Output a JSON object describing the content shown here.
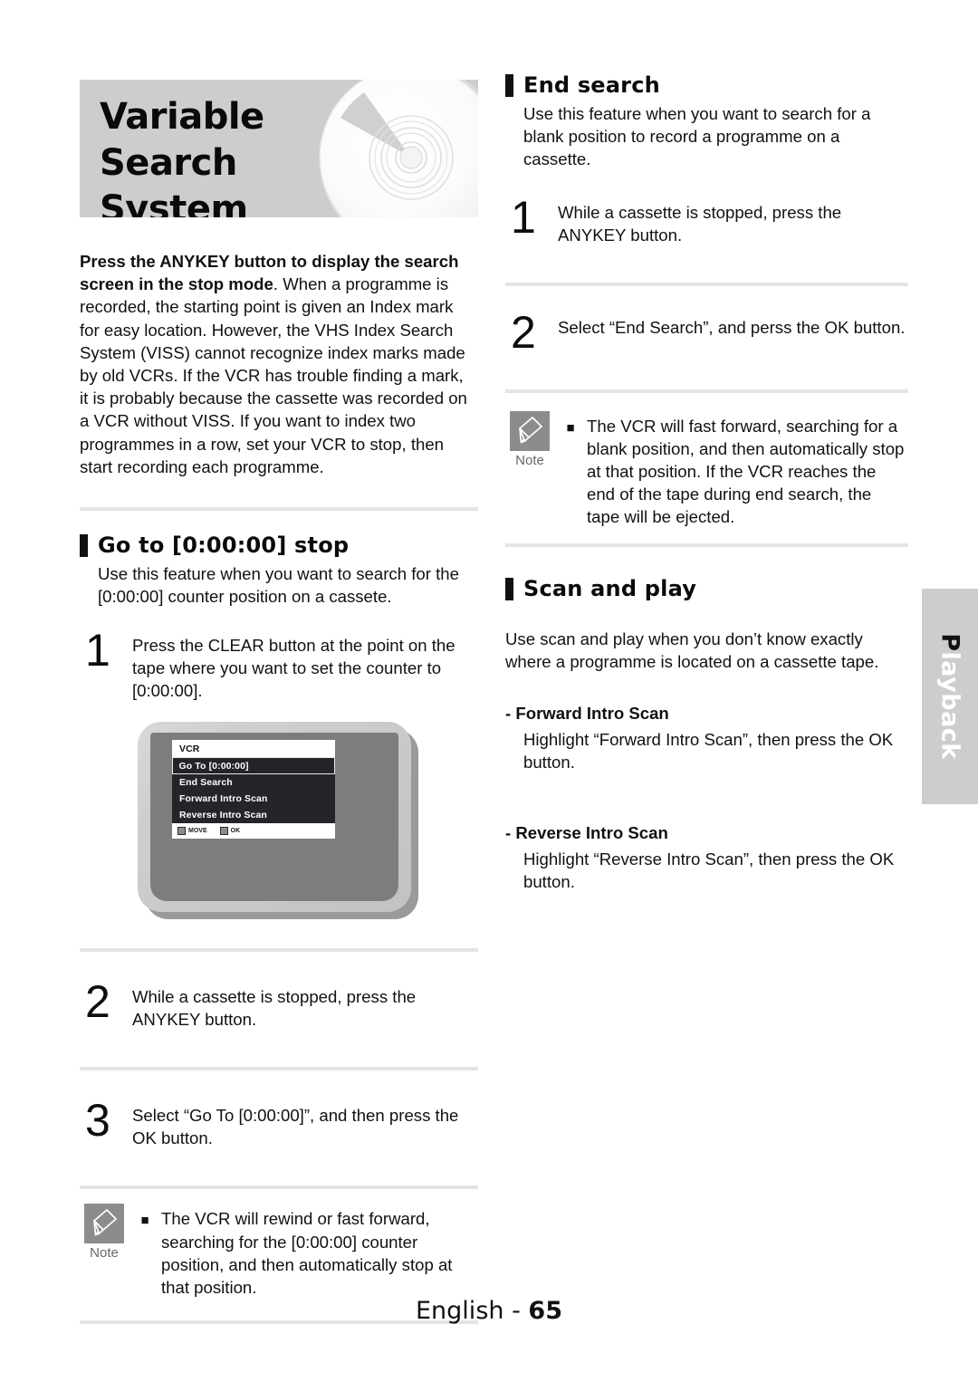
{
  "header": {
    "title_line1": "Variable Search",
    "title_line2": "System",
    "graphic": "compact-disc"
  },
  "left_column": {
    "intro_bold": "Press the ANYKEY button to display the search screen in the stop mode",
    "intro_rest": ". When a programme is recorded, the starting point is given an Index mark for easy location. However, the VHS Index Search System (VISS) cannot recognize index marks made by old VCRs. If the VCR has trouble finding a mark, it is probably because the cassette was recorded on a VCR without VISS. If you want to index two programmes in a row, set your VCR to stop, then start recording each programme.",
    "section": {
      "heading": "Go to [0:00:00] stop",
      "description": "Use this feature when you want to search for the [0:00:00] counter position on a cassete."
    },
    "steps": [
      {
        "number": "1",
        "text": "Press the CLEAR button at the point on the tape where you want to set the counter to [0:00:00]."
      },
      {
        "number": "2",
        "text": "While a cassette is stopped, press the ANYKEY button."
      },
      {
        "number": "3",
        "text": "Select “Go To [0:00:00]”, and then press the OK button."
      }
    ],
    "note": {
      "label": "Note",
      "bullet": "■",
      "text": "The VCR will rewind or fast forward, searching for the [0:00:00] counter position, and then automatically stop at that position."
    }
  },
  "osd": {
    "title": "VCR",
    "items": [
      {
        "label": "Go To [0:00:00]",
        "selected": true
      },
      {
        "label": "End Search",
        "selected": false
      },
      {
        "label": "Forward Intro Scan",
        "selected": false
      },
      {
        "label": "Reverse Intro Scan",
        "selected": false
      }
    ],
    "footer_keys": [
      {
        "icon": "dpad-updown-icon",
        "label": "MOVE"
      },
      {
        "icon": "enter-key-icon",
        "label": "OK"
      }
    ]
  },
  "right_column": {
    "end_search": {
      "heading": "End search",
      "description": "Use this feature when you want to search for a blank position to record a programme on a cassette.",
      "steps": [
        {
          "number": "1",
          "text": "While a cassette is stopped, press the ANYKEY button."
        },
        {
          "number": "2",
          "text": "Select “End Search”, and perss the OK button."
        }
      ],
      "note": {
        "label": "Note",
        "bullet": "■",
        "text": "The VCR will fast forward, searching for a blank position, and then automatically stop at that position. If the VCR reaches the end of the tape during end search, the tape will be ejected."
      }
    },
    "scan_and_play": {
      "heading": "Scan and play",
      "description": "Use scan and play when you don’t know exactly where a programme is located on a cassette tape.",
      "subsections": [
        {
          "title": "- Forward Intro Scan",
          "text": "Highlight “Forward Intro Scan”, then press the OK button."
        },
        {
          "title": "- Reverse Intro Scan",
          "text": "Highlight “Reverse Intro Scan”, then press the OK button."
        }
      ]
    }
  },
  "side_tab": {
    "first_letter": "P",
    "rest": "layback"
  },
  "footer": {
    "language": "English",
    "separator": " - ",
    "page": "65"
  },
  "colors": {
    "banner_bg": "#cdcdcd",
    "rule": "#e4e4e4",
    "note_badge": "#8c8c8c",
    "osd_item_bg": "#24242a",
    "tv_screen": "#7d7d7d",
    "side_tab_bg": "#cdcdcd"
  }
}
